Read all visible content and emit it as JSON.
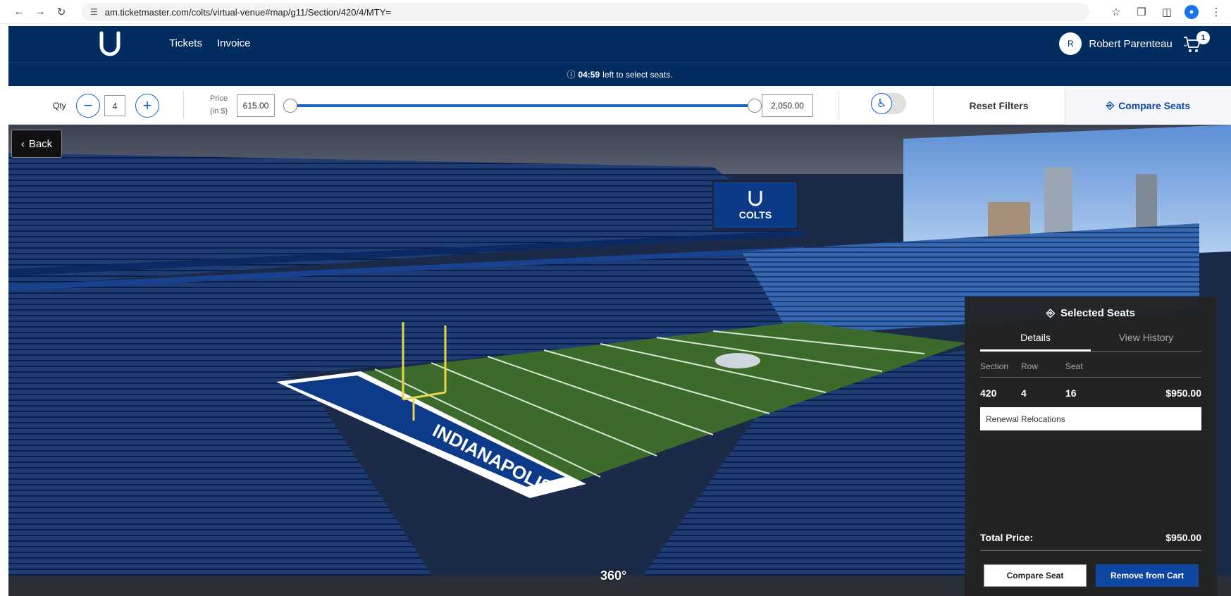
{
  "browser": {
    "url": "am.ticketmaster.com/colts/virtual-venue#map/g11/Section/420/4/MTY="
  },
  "header": {
    "nav": [
      {
        "label": "Tickets"
      },
      {
        "label": "Invoice"
      }
    ],
    "user": {
      "initial": "R",
      "name": "Robert Parenteau"
    },
    "cart_count": "1"
  },
  "timer": {
    "time": "04:59",
    "suffix": "left to select seats."
  },
  "filters": {
    "qty_label": "Qty",
    "qty_value": "4",
    "price_label": "Price",
    "price_unit": "(in $)",
    "price_min": "615.00",
    "price_max": "2,050.00",
    "reset_label": "Reset Filters",
    "compare_label": "Compare Seats"
  },
  "view": {
    "back_label": "Back",
    "view360_label": "360°",
    "end_zone_text": "INDIANAPOLIS",
    "board_text": "COLTS"
  },
  "seat_panel": {
    "title": "Selected Seats",
    "tabs": [
      {
        "label": "Details"
      },
      {
        "label": "View History"
      }
    ],
    "columns": [
      "Section",
      "Row",
      "Seat"
    ],
    "seat": {
      "section": "420",
      "row": "4",
      "seat": "16",
      "price": "$950.00"
    },
    "note": "Renewal Relocations",
    "total_label": "Total Price:",
    "total_value": "$950.00",
    "compare_button": "Compare Seat",
    "remove_button": "Remove from Cart"
  },
  "colors": {
    "brand_navy": "#002c5f",
    "accent_blue": "#1565c0",
    "turf_green": "#3c6a2b"
  }
}
